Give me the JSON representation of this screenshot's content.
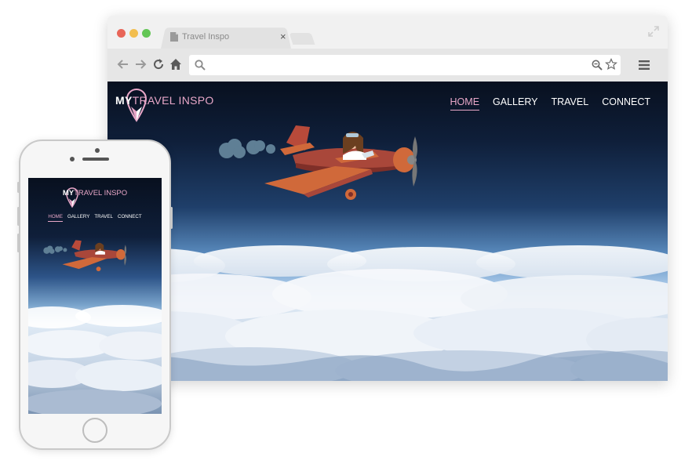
{
  "browser": {
    "tab_title": "Travel Inspo",
    "tab_close": "×",
    "address_value": "",
    "traffic_lights": {
      "red": "#e86558",
      "yellow": "#f2be4f",
      "green": "#62c655"
    },
    "icons": [
      "back-arrow-icon",
      "forward-arrow-icon",
      "reload-icon",
      "home-icon",
      "search-icon",
      "zoom-icon",
      "star-icon",
      "hamburger-menu-icon",
      "expand-icon",
      "document-icon"
    ]
  },
  "site": {
    "logo": {
      "my": "MY",
      "rest": "TRAVEL INSPO"
    },
    "nav": [
      {
        "label": "HOME",
        "active": true
      },
      {
        "label": "GALLERY",
        "active": false
      },
      {
        "label": "TRAVEL",
        "active": false
      },
      {
        "label": "CONNECT",
        "active": false
      }
    ],
    "accent_color": "#e8a7c8",
    "hero_illustration": "girl-flying-red-propeller-plane"
  },
  "phone": {
    "logo": {
      "my": "MY",
      "rest": "TRAVEL INSPO"
    },
    "nav": [
      {
        "label": "HOME",
        "active": true
      },
      {
        "label": "GALLERY",
        "active": false
      },
      {
        "label": "TRAVEL",
        "active": false
      },
      {
        "label": "CONNECT",
        "active": false
      }
    ]
  }
}
